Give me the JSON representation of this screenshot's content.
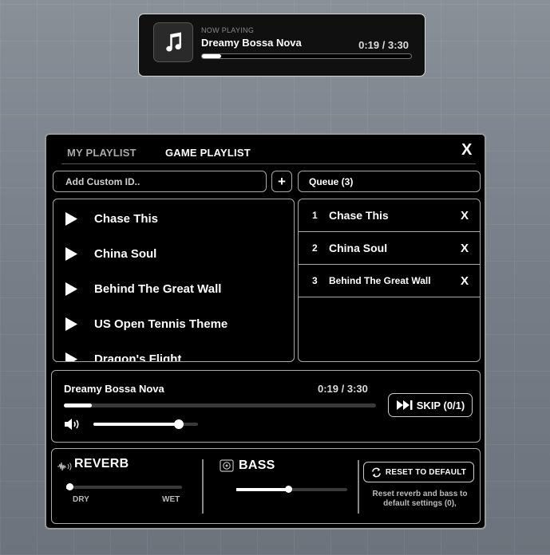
{
  "now_playing": {
    "label": "NOW PLAYING",
    "title": "Dreamy Bossa Nova",
    "time": "0:19 / 3:30",
    "progress": 0.09,
    "icon": "music-note-icon"
  },
  "panel": {
    "tabs": [
      {
        "label": "MY PLAYLIST",
        "active": false
      },
      {
        "label": "GAME PLAYLIST",
        "active": true
      }
    ],
    "close_label": "X",
    "custom_id_placeholder": "Add Custom ID..",
    "add_label": "+",
    "queue_header": "Queue (3)",
    "songs": [
      {
        "name": "Chase This"
      },
      {
        "name": "China Soul"
      },
      {
        "name": "Behind The Great Wall"
      },
      {
        "name": "US Open Tennis Theme"
      },
      {
        "name": "Dragon's Flight"
      }
    ],
    "queue": [
      {
        "num": "1",
        "name": "Chase This",
        "remove": "X"
      },
      {
        "num": "2",
        "name": "China Soul",
        "remove": "X"
      },
      {
        "num": "3",
        "name": "Behind The Great Wall",
        "remove": "X"
      }
    ],
    "player": {
      "title": "Dreamy Bossa Nova",
      "time": "0:19 / 3:30",
      "progress": 0.09,
      "volume": 0.82,
      "skip_label": "SKIP (0/1)"
    },
    "effects": {
      "reverb_title": "REVERB",
      "reverb_value": 0.03,
      "dry_label": "DRY",
      "wet_label": "WET",
      "bass_title": "BASS",
      "bass_value": 0.47,
      "reset_label": "RESET TO DEFAULT",
      "reset_desc": "Reset reverb and bass to default settings (0),"
    }
  }
}
